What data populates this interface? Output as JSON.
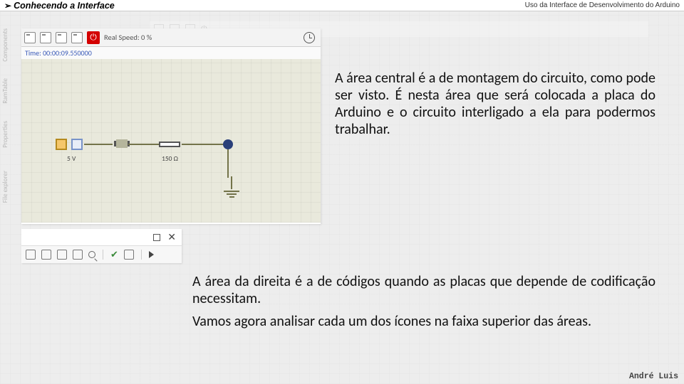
{
  "header": {
    "arrow": "➢",
    "title_left": "Conhecendo a Interface",
    "title_right": "Uso da Interface de Desenvolvimento do Arduino"
  },
  "panel1": {
    "toolbar": {
      "speed_label": "Real Speed: 0 %",
      "stop_glyph": "⏻",
      "time_label": "Time: 00:00:09.550000"
    },
    "circuit": {
      "source_label": "5 V",
      "resistor_label": "150 Ω"
    }
  },
  "panel2": {
    "maximize_glyph": "◻",
    "close_glyph": "✕",
    "check_glyph": "✔"
  },
  "body": {
    "p1": "A área central é a de montagem do circuito, como pode ser visto. É nesta área que será colocada a placa do Arduino e o circuito interligado a ela para podermos trabalhar.",
    "p2": "A área da direita é a de códigos quando as placas que depende de codificação necessitam.",
    "p3": "Vamos agora analisar cada um dos ícones na faixa superior das áreas."
  },
  "sidebar_tabs": [
    "Components",
    "RamTable",
    "Properties",
    "File explorer"
  ],
  "footer": {
    "author": "André Luis"
  }
}
